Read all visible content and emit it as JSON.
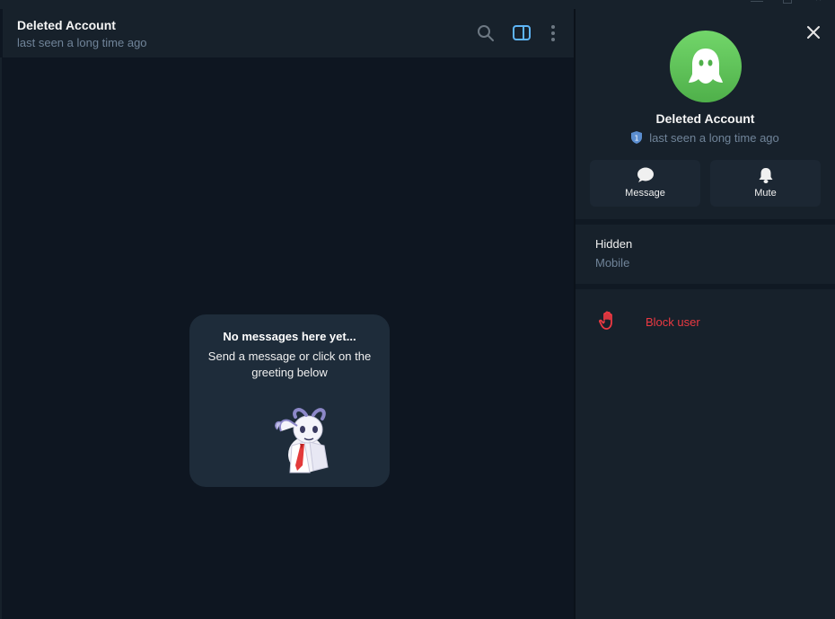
{
  "window": {
    "controls": [
      "minimize",
      "maximize",
      "close"
    ],
    "close_glyph": "×"
  },
  "chat_header": {
    "title": "Deleted Account",
    "status": "last seen a long time ago",
    "icons": [
      "search-icon",
      "side-panel-icon",
      "more-vertical-icon"
    ]
  },
  "empty_state": {
    "title": "No messages here yet...",
    "text": "Send a message or click on the greeting below",
    "sticker": "greeting-sticker"
  },
  "profile": {
    "name": "Deleted Account",
    "status": "last seen a long time ago",
    "shield_badge": "1",
    "avatar_icon": "ghost-icon",
    "avatar_color": "#5cc44f",
    "actions": [
      {
        "label": "Message",
        "icon": "chat-bubble-icon"
      },
      {
        "label": "Mute",
        "icon": "bell-icon"
      }
    ],
    "info": {
      "value": "Hidden",
      "label": "Mobile"
    },
    "block": {
      "label": "Block user",
      "icon": "hand-stop-icon",
      "color": "#ec3942"
    }
  },
  "colors": {
    "accent": "#5eb5f7",
    "background": "#0e1621",
    "panel": "#17212b",
    "card": "#1e2c3a",
    "muted_text": "#708499"
  }
}
